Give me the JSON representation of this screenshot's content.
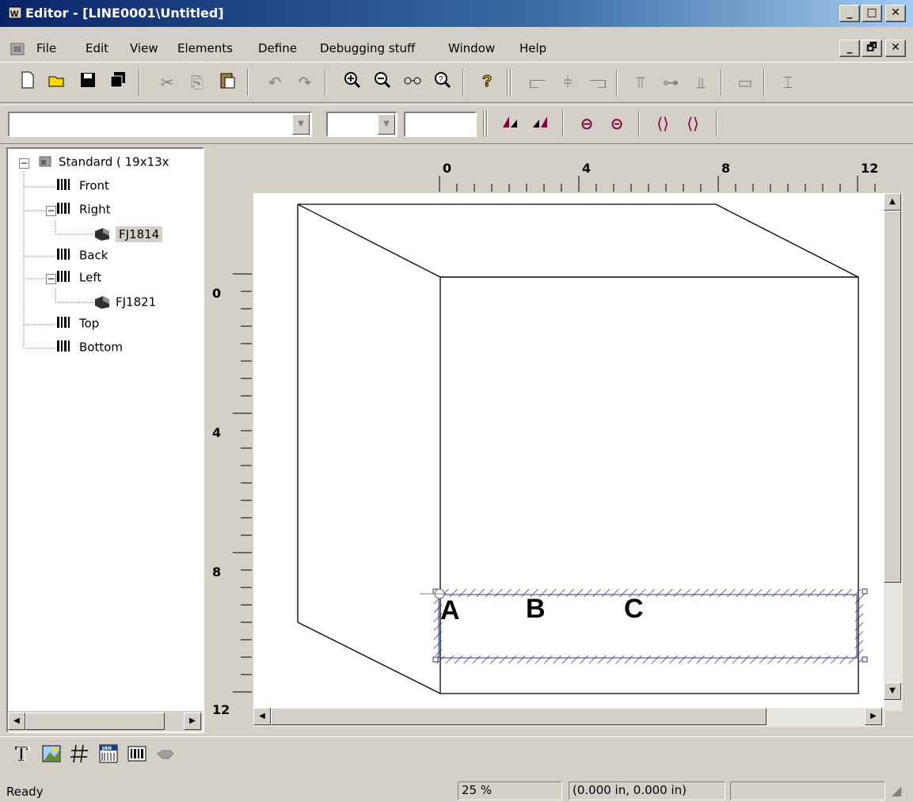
{
  "window": {
    "title": "Editor - [LINE0001\\Untitled]",
    "controls": {
      "minimize": "_",
      "maximize": "□",
      "close": "✕",
      "restore": "🗗"
    }
  },
  "menu": {
    "items": [
      {
        "label": "File"
      },
      {
        "label": "Edit"
      },
      {
        "label": "View"
      },
      {
        "label": "Elements"
      },
      {
        "label": "Define"
      },
      {
        "label": "Debugging stuff"
      },
      {
        "label": "Window"
      },
      {
        "label": "Help"
      }
    ]
  },
  "toolbar": {
    "icons": [
      "new-icon",
      "open-icon",
      "save-icon",
      "save-all-icon",
      "cut-icon",
      "copy-icon",
      "paste-icon",
      "undo-icon",
      "redo-icon",
      "zoom-in-icon",
      "zoom-out-icon",
      "glasses-icon",
      "zoom-search-icon",
      "help-icon",
      "align-left-icon",
      "align-center-icon",
      "align-right-icon",
      "align-top-icon",
      "align-middle-icon",
      "align-bottom-icon",
      "same-width-icon",
      "same-height-icon"
    ]
  },
  "tree": {
    "root": "Standard ( 19x13x",
    "items": [
      {
        "label": "Front"
      },
      {
        "label": "Right"
      },
      {
        "label": "FJ1814"
      },
      {
        "label": "Back"
      },
      {
        "label": "Left"
      },
      {
        "label": "FJ1821"
      },
      {
        "label": "Top"
      },
      {
        "label": "Bottom"
      }
    ]
  },
  "ruler": {
    "horizontal_labels": [
      "0",
      "4",
      "8",
      "12"
    ],
    "vertical_labels": [
      "0",
      "4",
      "8",
      "12"
    ]
  },
  "canvas": {
    "labels": [
      "A",
      "B",
      "C"
    ]
  },
  "status": {
    "text": "Ready",
    "zoom": "25 %",
    "coords": "(0.000 in, 0.000 in)"
  },
  "palette": {
    "icons": [
      "text-tool-icon",
      "image-tool-icon",
      "hash-tool-icon",
      "jan-barcode-tool-icon",
      "barcode-tool-icon",
      "hand-tool-icon"
    ]
  }
}
